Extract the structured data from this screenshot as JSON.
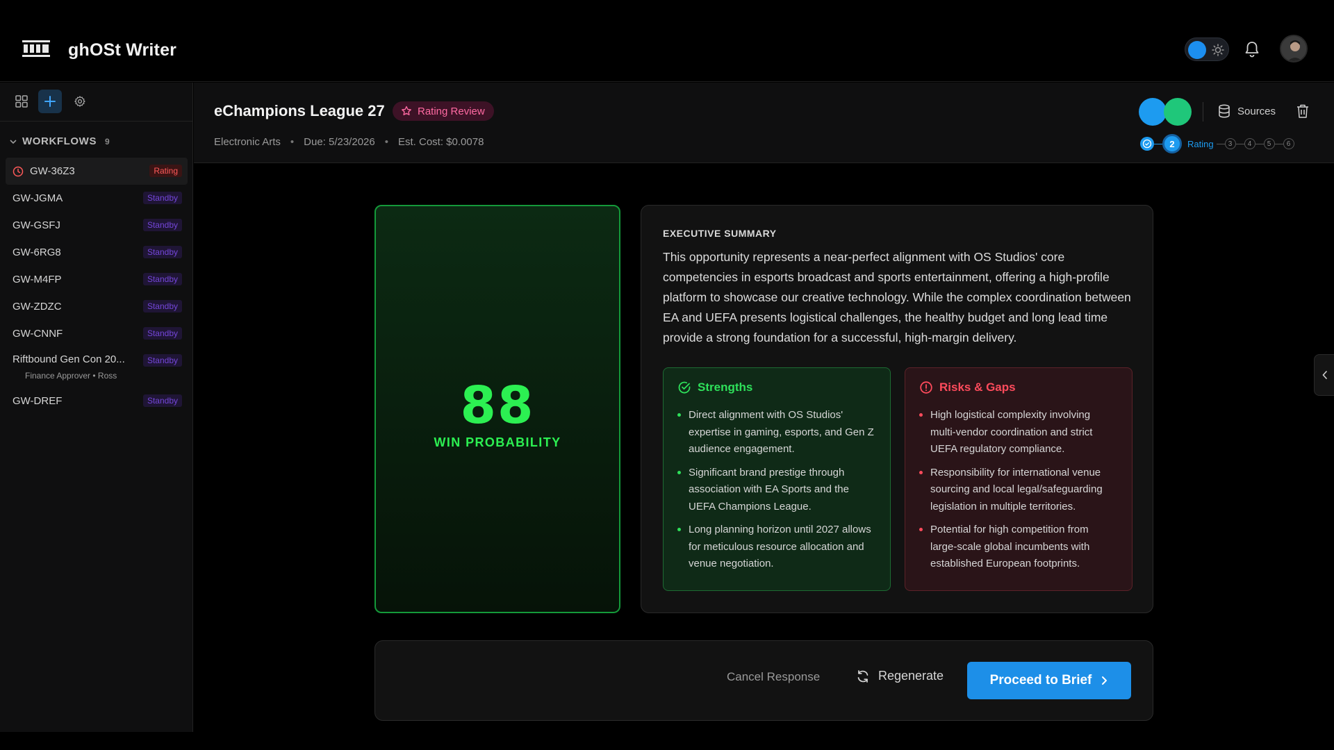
{
  "app": {
    "title": "ghOSt Writer"
  },
  "colors": {
    "accent": "#1d8fe8",
    "success": "#2cf052",
    "danger": "#ff4b5c",
    "standby": "#7446d9"
  },
  "sidebar": {
    "section_title": "WORKFLOWS",
    "count": "9",
    "items": [
      {
        "label": "GW-36Z3",
        "status": "Rating",
        "active": true
      },
      {
        "label": "GW-JGMA",
        "status": "Standby"
      },
      {
        "label": "GW-GSFJ",
        "status": "Standby"
      },
      {
        "label": "GW-6RG8",
        "status": "Standby"
      },
      {
        "label": "GW-M4FP",
        "status": "Standby"
      },
      {
        "label": "GW-ZDZC",
        "status": "Standby"
      },
      {
        "label": "GW-CNNF",
        "status": "Standby"
      },
      {
        "label": "Riftbound Gen Con 20...",
        "sub": "Finance Approver • Ross",
        "status": "Standby"
      },
      {
        "label": "GW-DREF",
        "status": "Standby"
      }
    ]
  },
  "project": {
    "title": "eChampions League 27",
    "badge": "Rating Review",
    "client": "Electronic Arts",
    "due": "Due: 5/23/2026",
    "cost": "Est. Cost: $0.0078",
    "sources_label": "Sources",
    "stepper": {
      "current_step": "2",
      "current_label": "Rating",
      "future_steps": [
        "3",
        "4",
        "5",
        "6"
      ]
    }
  },
  "score": {
    "value": "88",
    "label": "WIN PROBABILITY"
  },
  "summary": {
    "label": "EXECUTIVE SUMMARY",
    "text": "This opportunity represents a near-perfect alignment with OS Studios' core competencies in esports broadcast and sports entertainment, offering a high-profile platform to showcase our creative technology. While the complex coordination between EA and UEFA presents logistical challenges, the healthy budget and long lead time provide a strong foundation for a successful, high-margin delivery."
  },
  "strengths": {
    "title": "Strengths",
    "items": [
      "Direct alignment with OS Studios' expertise in gaming, esports, and Gen Z audience engagement.",
      "Significant brand prestige through association with EA Sports and the UEFA Champions League.",
      "Long planning horizon until 2027 allows for meticulous resource allocation and venue negotiation."
    ]
  },
  "risks": {
    "title": "Risks & Gaps",
    "items": [
      "High logistical complexity involving multi-vendor coordination and strict UEFA regulatory compliance.",
      "Responsibility for international venue sourcing and local legal/safeguarding legislation in multiple territories.",
      "Potential for high competition from large-scale global incumbents with established European footprints."
    ]
  },
  "actions": {
    "cancel": "Cancel Response",
    "regenerate": "Regenerate",
    "proceed": "Proceed to Brief"
  }
}
